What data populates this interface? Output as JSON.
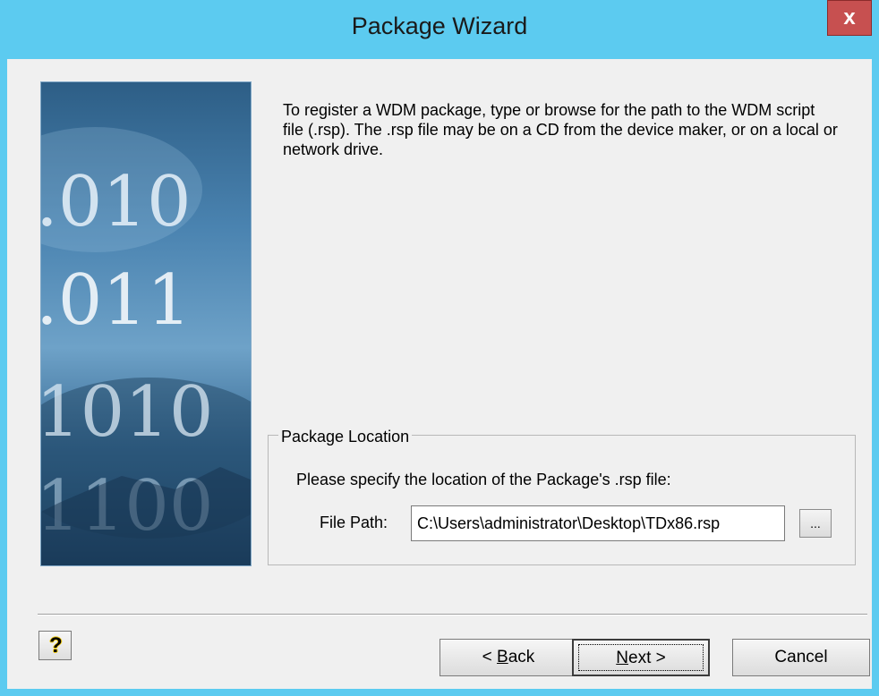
{
  "window": {
    "title": "Package Wizard",
    "close_label": "x"
  },
  "intro_text": "To register a WDM package, type or browse for the path to the WDM script file (.rsp). The .rsp file may be on a CD from the device maker, or on a local or network drive.",
  "package_location": {
    "legend": "Package Location",
    "instruction": "Please specify the location of the Package's .rsp file:",
    "file_path_label": "File Path:",
    "file_path_value": "C:\\Users\\administrator\\Desktop\\TDx86.rsp",
    "browse_label": "..."
  },
  "side_image": {
    "digits": [
      ".010",
      ".011",
      "1010",
      "1100"
    ]
  },
  "buttons": {
    "help_icon": "?",
    "back_accel": "B",
    "back_prefix": "< ",
    "back_rest": "ack",
    "next_accel": "N",
    "next_rest": "ext >",
    "cancel": "Cancel"
  },
  "colors": {
    "titlebar": "#5ccbf0",
    "close": "#c75050"
  }
}
